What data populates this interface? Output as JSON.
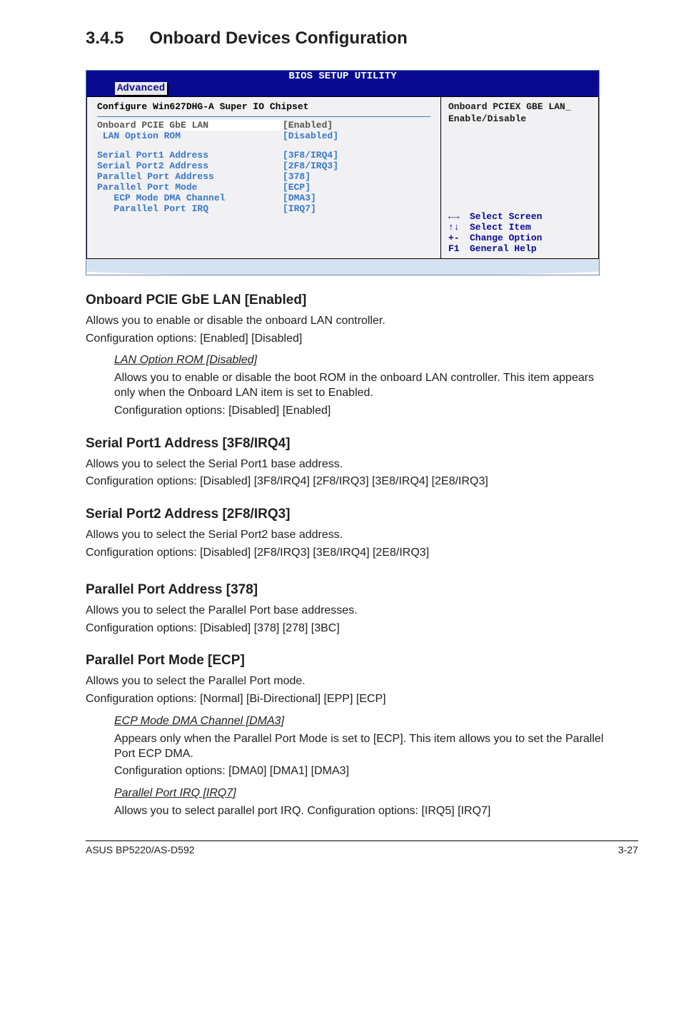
{
  "heading": {
    "number": "3.4.5",
    "title": "Onboard Devices Configuration"
  },
  "bios": {
    "title": "BIOS SETUP UTILITY",
    "tab": "Advanced",
    "left_header": "Configure Win627DHG-A Super IO Chipset",
    "rows": [
      {
        "label": "Onboard PCIE GbE LAN",
        "value": "[Enabled]",
        "selected": true
      },
      {
        "label": " LAN Option ROM",
        "value": "[Disabled]"
      }
    ],
    "rows2": [
      {
        "label": "Serial Port1 Address",
        "value": "[3F8/IRQ4]"
      },
      {
        "label": "Serial Port2 Address",
        "value": "[2F8/IRQ3]"
      },
      {
        "label": "Parallel Port Address",
        "value": "[378]"
      },
      {
        "label": "Parallel Port Mode",
        "value": "[ECP]"
      },
      {
        "label": "   ECP Mode DMA Channel",
        "value": "[DMA3]"
      },
      {
        "label": "   Parallel Port IRQ",
        "value": "[IRQ7]"
      }
    ],
    "help": [
      "Onboard PCIEX GBE LAN_",
      "Enable/Disable"
    ],
    "legend": [
      {
        "key": "←→",
        "text": "Select Screen"
      },
      {
        "key": "↑↓",
        "text": "Select Item"
      },
      {
        "key": "+-",
        "text": "Change Option"
      },
      {
        "key": "F1",
        "text": "General Help"
      }
    ]
  },
  "s1": {
    "h": "Onboard PCIE GbE LAN [Enabled]",
    "p1": "Allows you to enable or disable the onboard LAN controller.",
    "p2": "Configuration options: [Enabled] [Disabled]",
    "sub_h": "LAN Option ROM [Disabled]",
    "sub_p1": "Allows you to enable or disable the boot ROM in the onboard LAN controller. This item appears only when the Onboard LAN item is set to Enabled.",
    "sub_p2": "Configuration options: [Disabled] [Enabled]"
  },
  "s2": {
    "h": "Serial Port1 Address [3F8/IRQ4]",
    "p1": "Allows you to select the Serial Port1 base address.",
    "p2": "Configuration options: [Disabled] [3F8/IRQ4] [2F8/IRQ3] [3E8/IRQ4] [2E8/IRQ3]"
  },
  "s3": {
    "h": "Serial Port2 Address [2F8/IRQ3]",
    "p1": "Allows you to select the Serial Port2 base address.",
    "p2": "Configuration options: [Disabled] [2F8/IRQ3] [3E8/IRQ4] [2E8/IRQ3]"
  },
  "s4": {
    "h": "Parallel Port Address [378]",
    "p1": "Allows you to select the Parallel Port base addresses.",
    "p2": "Configuration options: [Disabled] [378] [278] [3BC]"
  },
  "s5": {
    "h": "Parallel Port Mode [ECP]",
    "p1": "Allows you to select the Parallel Port  mode.",
    "p2": "Configuration options: [Normal] [Bi-Directional] [EPP] [ECP]",
    "sub1_h": "ECP Mode DMA Channel [DMA3]",
    "sub1_p1": "Appears only when the Parallel Port Mode is set to [ECP]. This item allows you to set the Parallel Port ECP DMA.",
    "sub1_p2": "Configuration options: [DMA0] [DMA1] [DMA3]",
    "sub2_h": "Parallel Port IRQ [IRQ7]",
    "sub2_p1": "Allows you to select parallel port IRQ. Configuration options: [IRQ5] [IRQ7]"
  },
  "footer": {
    "left": "ASUS BP5220/AS-D592",
    "right": "3-27"
  }
}
